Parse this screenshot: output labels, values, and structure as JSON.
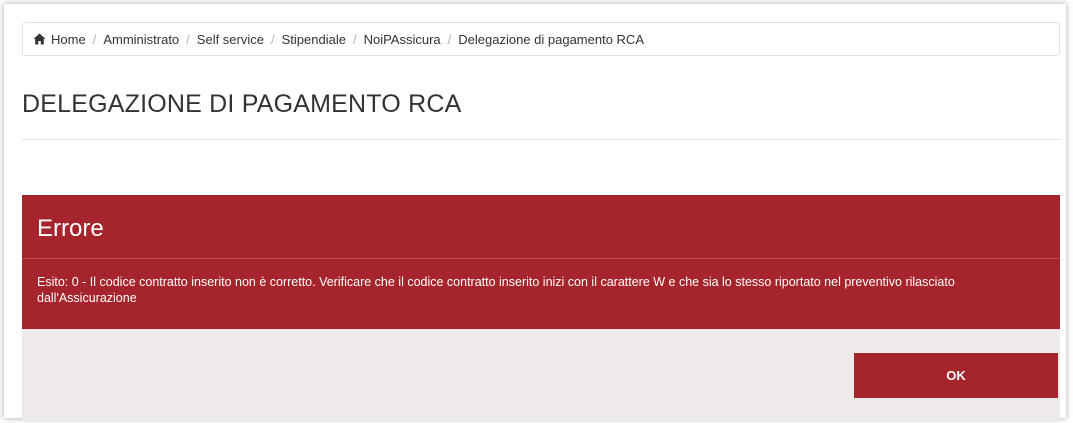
{
  "breadcrumb": {
    "home_icon": "home-icon",
    "items": [
      "Home",
      "Amministrato",
      "Self service",
      "Stipendiale",
      "NoiPAssicura",
      "Delegazione di pagamento RCA"
    ],
    "separator": "/"
  },
  "page": {
    "title": "DELEGAZIONE DI PAGAMENTO RCA"
  },
  "error_modal": {
    "title": "Errore",
    "message": "Esito: 0 - Il codice contratto inserito non è corretto. Verificare che il codice contratto inserito inizi con il carattere W e che sia lo stesso riportato nel preventivo rilasciato dall'Assicurazione",
    "ok_label": "OK"
  },
  "colors": {
    "accent": "#a6242b",
    "footer_bg": "#eeeaea"
  }
}
